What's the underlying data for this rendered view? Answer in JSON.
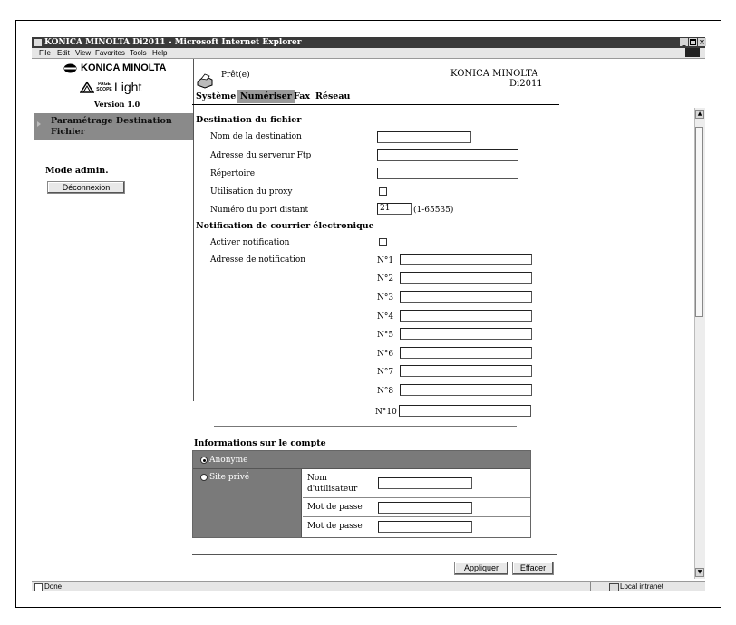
{
  "window": {
    "title": "KONICA MINOLTA Di2011 - Microsoft Internet Explorer",
    "controls": [
      "_",
      "×"
    ],
    "menu": [
      "File",
      "Edit",
      "View",
      "Favorites",
      "Tools",
      "Help"
    ]
  },
  "brand": {
    "company": "KONICA MINOLTA",
    "product_a": "PAGE SCOPE",
    "product_b": "Light",
    "version": "Version 1.0"
  },
  "status": {
    "ready": "Prêt(e)",
    "device_brand": "KONICA MINOLTA",
    "device_model": "Di2011"
  },
  "tabs": [
    {
      "label": "Système",
      "active": false
    },
    {
      "label": "Numériser",
      "active": true
    },
    {
      "label": "Fax",
      "active": false
    },
    {
      "label": "Réseau",
      "active": false
    }
  ],
  "sidebar": {
    "active_item": "Paramétrage Destination Fichier",
    "mode": "Mode admin.",
    "logout": "Déconnexion"
  },
  "file_destination": {
    "heading": "Destination du fichier",
    "fields": [
      {
        "label": "Nom de la destination",
        "value": ""
      },
      {
        "label": "Adresse du serverur Ftp",
        "value": ""
      },
      {
        "label": "Répertoire",
        "value": ""
      }
    ],
    "proxy_label": "Utilisation du proxy",
    "proxy_checked": false,
    "port_label": "Numéro du port distant",
    "port_value": "21",
    "port_range": "(1-65535)"
  },
  "email_notification": {
    "heading": "Notification de courrier électronique",
    "enable_label": "Activer notification",
    "enable_checked": false,
    "address_label": "Adresse de notification",
    "addresses": [
      {
        "label": "N°1",
        "value": ""
      },
      {
        "label": "N°2",
        "value": ""
      },
      {
        "label": "N°3",
        "value": ""
      },
      {
        "label": "N°4",
        "value": ""
      },
      {
        "label": "N°5",
        "value": ""
      },
      {
        "label": "N°6",
        "value": ""
      },
      {
        "label": "N°7",
        "value": ""
      },
      {
        "label": "N°8",
        "value": ""
      },
      {
        "label": "N°10",
        "value": ""
      }
    ]
  },
  "account": {
    "heading": "Informations sur le compte",
    "anonymous_label": "Anonyme",
    "anonymous_selected": true,
    "private_label": "Site privé",
    "private_selected": false,
    "username_label": "Nom d'utilisateur",
    "username_value": "",
    "password_label": "Mot de passe",
    "password_value": "",
    "password_confirm_label": "Mot de passe",
    "password_confirm_value": ""
  },
  "actions": {
    "apply": "Appliquer",
    "clear": "Effacer"
  },
  "statusbar": {
    "left": "Done",
    "zone": "Local intranet"
  },
  "colors": {
    "title_bar": "#3a3a3a",
    "nav_active": "#8a8a8a",
    "table_header": "#7a7a7a"
  }
}
